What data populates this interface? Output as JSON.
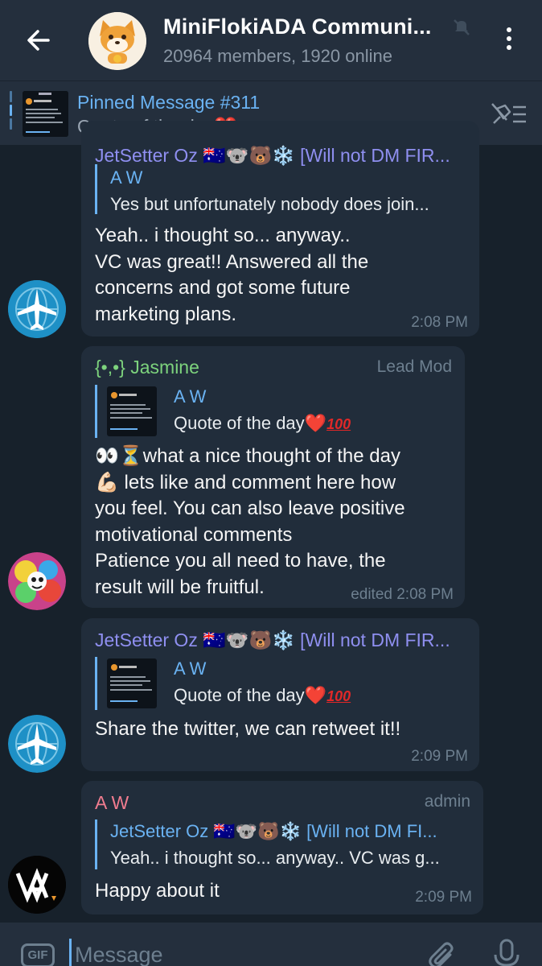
{
  "header": {
    "title": "MiniFlokiADA Communi...",
    "subtitle": "20964 members, 1920 online",
    "back_icon": "arrow-left-icon",
    "mute_icon": "muted-bell-icon",
    "menu_icon": "vertical-dots-icon"
  },
  "pinned": {
    "title": "Pinned Message #311",
    "text": "Quote of the day",
    "unpin_icon": "unpin-list-icon"
  },
  "messages": [
    {
      "sender": "JetSetter Oz 🇦🇺🐨🐻❄️ [Will not DM FIR...",
      "reply_name": "A W",
      "reply_text": "Yes but unfortunately nobody does join...",
      "lines": [
        "Yeah.. i thought so... anyway..",
        "VC was great!! Answered all the",
        "concerns and got some future",
        "marketing plans."
      ],
      "time": "2:08 PM"
    },
    {
      "sender": "{•,•} Jasmine",
      "role": "Lead Mod",
      "reply_name": "A W",
      "reply_text": "Quote of the day",
      "lines": [
        "👀⏳what a nice thought of the day",
        "💪🏻 lets like and comment here how",
        "you feel. You can also leave positive",
        "motivational comments",
        "Patience you all need to have, the",
        "result will be fruitful."
      ],
      "time": "edited 2:08 PM"
    },
    {
      "sender": "JetSetter Oz 🇦🇺🐨🐻❄️ [Will not DM FIR...",
      "reply_name": "A W",
      "reply_text": "Quote of the day",
      "lines": [
        "Share the twitter, we can retweet it!!"
      ],
      "time": "2:09 PM"
    },
    {
      "sender": "A W",
      "role": "admin",
      "reply_name": "JetSetter Oz 🇦🇺🐨🐻❄️ [Will not DM FI...",
      "reply_text": "Yeah.. i thought so... anyway.. VC was g...",
      "lines": [
        "Happy about it"
      ],
      "time": "2:09 PM"
    }
  ],
  "input": {
    "gif_label": "GIF",
    "placeholder": "Message",
    "attach_icon": "paperclip-icon",
    "mic_icon": "microphone-icon"
  },
  "colors": {
    "background": "#17212b",
    "header": "#242f3d",
    "bubble": "#212d3b",
    "accent": "#6ab2f2",
    "jetsetter_name": "#8f8ff0",
    "jasmine_name": "#7dd37d",
    "aw_name": "#f07c8f"
  }
}
